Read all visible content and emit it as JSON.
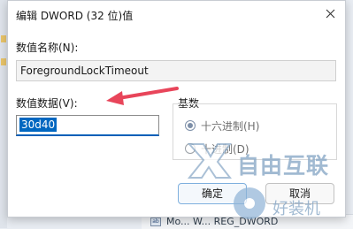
{
  "dialog": {
    "title": "编辑 DWORD (32 位)值",
    "name_label": "数值名称(N):",
    "name_value": "ForegroundLockTimeout",
    "data_label": "数值数据(V):",
    "data_value": "30d40",
    "base_label": "基数",
    "base_options": [
      {
        "label": "十六进制(H)",
        "checked": true
      },
      {
        "label": "十进制(D)",
        "checked": false
      }
    ],
    "ok_label": "确定",
    "cancel_label": "取消"
  },
  "background": {
    "row_icon": "ab",
    "row_text": "Mo... W... REG_DWORD"
  },
  "watermark": {
    "brand": "自由互联",
    "sub": "好装机"
  },
  "colors": {
    "selection": "#0067c0",
    "focus_underline": "#005fb8",
    "annotation_arrow": "#e8455a",
    "watermark": "#8aa9c7"
  },
  "icons": [
    "close-icon",
    "arrow-annotation-icon",
    "watermark-logo-icon",
    "registry-value-icon",
    "folder-icon"
  ]
}
